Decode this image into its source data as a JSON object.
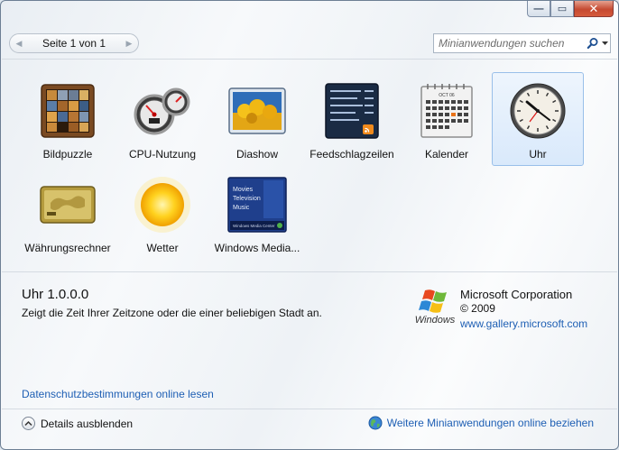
{
  "window": {
    "caption": {
      "minimize": "—",
      "maximize": "▭",
      "close": "✕"
    }
  },
  "toolbar": {
    "page_label": "Seite 1 von 1",
    "search_placeholder": "Minianwendungen suchen"
  },
  "gadgets": [
    {
      "label": "Bildpuzzle",
      "icon": "picture-puzzle-icon",
      "selected": false
    },
    {
      "label": "CPU-Nutzung",
      "icon": "cpu-meter-icon",
      "selected": false
    },
    {
      "label": "Diashow",
      "icon": "slideshow-icon",
      "selected": false
    },
    {
      "label": "Feedschlagzeilen",
      "icon": "feed-headlines-icon",
      "selected": false
    },
    {
      "label": "Kalender",
      "icon": "calendar-icon",
      "selected": false
    },
    {
      "label": "Uhr",
      "icon": "clock-icon",
      "selected": true
    },
    {
      "label": "Währungsrechner",
      "icon": "currency-icon",
      "selected": false
    },
    {
      "label": "Wetter",
      "icon": "weather-sun-icon",
      "selected": false
    },
    {
      "label": "Windows Media...",
      "icon": "media-center-icon",
      "selected": false
    }
  ],
  "thumb_text": {
    "calendar_month": "OCT 06",
    "media_lines": [
      "Movies",
      "Television",
      "Music"
    ],
    "media_footer": "Windows Media Center"
  },
  "details": {
    "name": "Uhr 1.0.0.0",
    "description": "Zeigt die Zeit Ihrer Zeitzone oder die einer beliebigen Stadt an.",
    "logo_text": "Windows",
    "publisher": "Microsoft Corporation",
    "copyright": "© 2009",
    "link": "www.gallery.microsoft.com"
  },
  "footer": {
    "privacy_link": "Datenschutzbestimmungen online lesen",
    "hide_details": "Details ausblenden",
    "more_online": "Weitere Minianwendungen online beziehen"
  },
  "colors": {
    "link": "#1e5fb4",
    "selection_fill": "#d9e9fb",
    "selection_border": "#99bfe9",
    "close_button": "#c54a31"
  }
}
